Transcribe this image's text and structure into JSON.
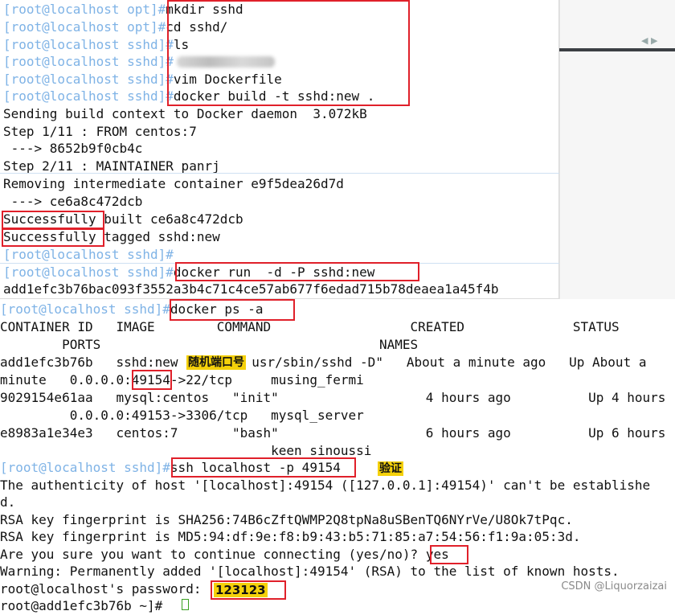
{
  "watermark": "CSDN @Liquorzaizai",
  "colors": {
    "prompt": "#7fb3e6",
    "highlight_box": "#e0202a",
    "annotation_bg": "#f5d10a"
  },
  "session1": {
    "lines": [
      {
        "prompt": "[root@localhost opt]#",
        "cmd": "mkdir sshd"
      },
      {
        "prompt": "[root@localhost opt]#",
        "cmd": "cd sshd/"
      },
      {
        "prompt": "[root@localhost sshd]#",
        "cmd": "ls"
      },
      {
        "prompt": "[root@localhost sshd]#",
        "cmd": ""
      },
      {
        "prompt": "[root@localhost sshd]#",
        "cmd": "vim Dockerfile"
      },
      {
        "prompt": "[root@localhost sshd]#",
        "cmd": "docker build -t sshd:new ."
      }
    ],
    "output": [
      "Sending build context to Docker daemon  3.072kB",
      "Step 1/11 : FROM centos:7",
      " ---> 8652b9f0cb4c",
      "Step 2/11 : MAINTAINER panrj",
      "Removing intermediate container e9f5dea26d7d",
      " ---> ce6a8c472dcb"
    ],
    "success1_word": "Successfully",
    "success1_rest": " built ce6a8c472dcb",
    "success2_word": "Successfully",
    "success2_rest": " tagged sshd:new",
    "empty_prompt": "[root@localhost sshd]#",
    "run_prompt": "[root@localhost sshd]#",
    "run_cmd": "docker run  -d -P sshd:new",
    "container_hash": "add1efc3b76bac093f3552a3b4c71c4ce57ab677f6edad715b78deaea1a45f4b"
  },
  "session2": {
    "ps_prompt": "[root@localhost sshd]#",
    "ps_cmd": "docker ps -a",
    "header1": "CONTAINER ID   IMAGE        COMMAND                  CREATED              STATUS",
    "header2": "        PORTS                                    NAMES",
    "row1a_pre": "add1efc3b76b   sshd:new ",
    "row1a_post": "usr/sbin/sshd -D\"   About a minute ago   Up About a",
    "row1b_pre": "minute   0.0.0.0:",
    "row1b_port": "49154",
    "row1b_post": "->22/tcp     musing_fermi",
    "row2a": "9029154e61aa   mysql:centos   \"init\"                   4 hours ago          Up 4 hours",
    "row2b": "         0.0.0.0:49153->3306/tcp   mysql_server",
    "row3a": "e8983a1e34e3   centos:7       \"bash\"                   6 hours ago          Up 6 hours",
    "row3b": "                                   keen_sinoussi",
    "ssh_prompt": "[root@localhost sshd]#",
    "ssh_cmd": "ssh localhost -p 49154",
    "auth1": "The authenticity of host '[localhost]:49154 ([127.0.0.1]:49154)' can't be establishe",
    "auth2": "d.",
    "rsa_sha": "RSA key fingerprint is SHA256:74B6cZftQWMP2Q8tpNa8uSBenTQ6NYrVe/U8Ok7tPqc.",
    "rsa_md5": "RSA key fingerprint is MD5:94:df:9e:f8:b9:43:b5:71:85:a7:54:56:f1:9a:05:3d.",
    "question": "Are you sure you want to continue connecting (yes/no)? ",
    "answer": "yes",
    "warning": "Warning: Permanently added '[localhost]:49154' (RSA) to the list of known hosts.",
    "password_prompt": "root@localhost's password: ",
    "last_line": "root@add1efc3b76b ~]#"
  },
  "annotations": {
    "random_port": "随机端口号",
    "verify": "验证",
    "password": "123123"
  }
}
